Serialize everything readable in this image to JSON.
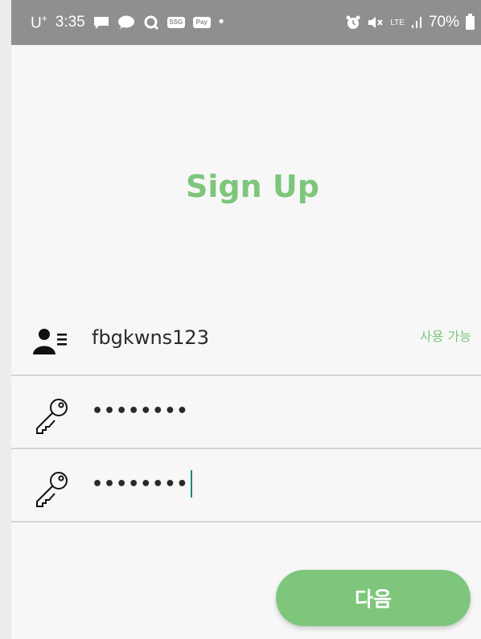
{
  "status_bar": {
    "carrier": "U",
    "carrier_sup": "+",
    "time": "3:35",
    "noti_talk": "TALK",
    "noti_ssg": "SSG",
    "noti_pay": "Pay",
    "dot": "•",
    "network": "LTE",
    "battery": "70%"
  },
  "title": "Sign Up",
  "form": {
    "id_value": "fbgkwns123",
    "id_status": "사용 가능",
    "password_value": "••••••••",
    "confirm_value": "••••••••"
  },
  "next_button": "다음",
  "colors": {
    "accent": "#7dc67c",
    "status_bar": "#8f8f8f",
    "background": "#f7f7f7"
  },
  "icons": [
    "user-card-icon",
    "key-icon",
    "key-icon"
  ]
}
